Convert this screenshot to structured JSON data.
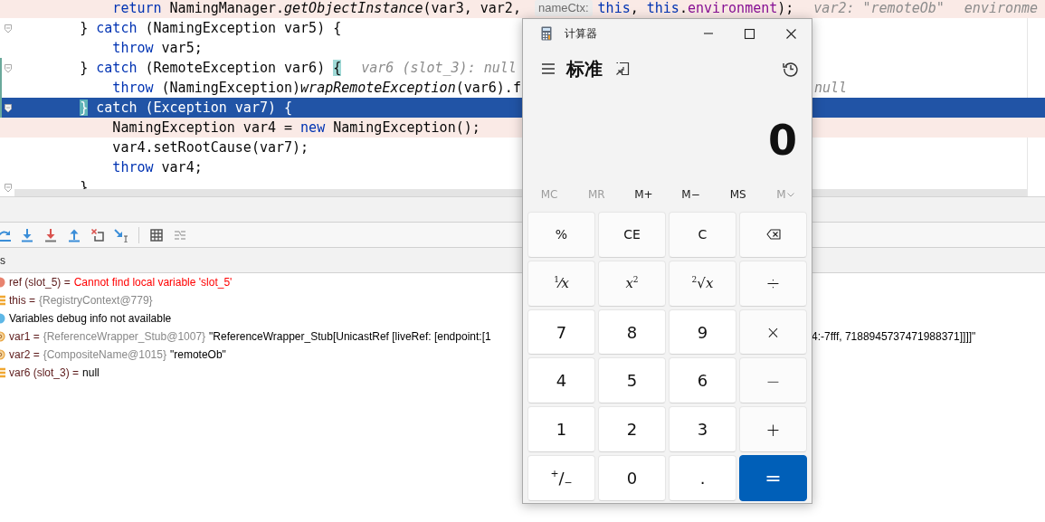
{
  "editor": {
    "lines": [
      {
        "breakpoint": true,
        "current": false,
        "foldable": false,
        "changed": false,
        "tokens": [
          {
            "text": "            return",
            "kind": "keyword"
          },
          {
            "text": " NamingManager.",
            "kind": "plain"
          },
          {
            "text": "getObjectInstance",
            "kind": "static"
          },
          {
            "text": "(var3, var2, ",
            "kind": "plain"
          },
          {
            "text": "nameCtx:",
            "kind": "inlay"
          },
          {
            "text": "this",
            "kind": "keyword"
          },
          {
            "text": ", ",
            "kind": "plain"
          },
          {
            "text": "this",
            "kind": "keyword"
          },
          {
            "text": ".",
            "kind": "plain"
          },
          {
            "text": "environment",
            "kind": "field"
          },
          {
            "text": ");",
            "kind": "plain"
          },
          {
            "text": "var2: \"remoteOb\"",
            "kind": "hint"
          },
          {
            "text": "environme",
            "kind": "hint"
          }
        ]
      },
      {
        "breakpoint": false,
        "current": false,
        "foldable": true,
        "changed": false,
        "tokens": [
          {
            "text": "        } ",
            "kind": "plain"
          },
          {
            "text": "catch",
            "kind": "keyword"
          },
          {
            "text": " (NamingException var5) {",
            "kind": "plain"
          }
        ]
      },
      {
        "breakpoint": false,
        "current": false,
        "foldable": false,
        "changed": false,
        "tokens": [
          {
            "text": "            throw",
            "kind": "keyword"
          },
          {
            "text": " var5;",
            "kind": "plain"
          }
        ]
      },
      {
        "breakpoint": false,
        "current": false,
        "foldable": true,
        "changed": true,
        "tokens": [
          {
            "text": "        } ",
            "kind": "plain"
          },
          {
            "text": "catch",
            "kind": "keyword"
          },
          {
            "text": " (RemoteException var6) ",
            "kind": "plain"
          },
          {
            "text": "{",
            "kind": "brace"
          },
          {
            "text": "var6 (slot_3): null",
            "kind": "hint"
          }
        ]
      },
      {
        "breakpoint": false,
        "current": false,
        "foldable": false,
        "changed": true,
        "tokens": [
          {
            "text": "            throw",
            "kind": "keyword"
          },
          {
            "text": " (NamingException)",
            "kind": "plain"
          },
          {
            "text": "wrapRemoteException",
            "kind": "static"
          },
          {
            "text": "(var6).f",
            "kind": "plain"
          }
        ],
        "tail": [
          {
            "text": "null",
            "kind": "hint"
          }
        ]
      },
      {
        "breakpoint": false,
        "current": true,
        "foldable": true,
        "changed": true,
        "tokens": [
          {
            "text": "        }",
            "kind": "brace"
          },
          {
            "text": " catch",
            "kind": "keyword"
          },
          {
            "text": " (Exception var7) {",
            "kind": "plain"
          }
        ]
      },
      {
        "breakpoint": true,
        "current": false,
        "foldable": false,
        "changed": false,
        "tokens": [
          {
            "text": "            NamingException var4 = ",
            "kind": "plain"
          },
          {
            "text": "new",
            "kind": "keyword"
          },
          {
            "text": " NamingException();",
            "kind": "plain"
          }
        ]
      },
      {
        "breakpoint": false,
        "current": false,
        "foldable": false,
        "changed": false,
        "tokens": [
          {
            "text": "            var4.setRootCause(var7);",
            "kind": "plain"
          }
        ]
      },
      {
        "breakpoint": false,
        "current": false,
        "foldable": false,
        "changed": false,
        "tokens": [
          {
            "text": "            throw",
            "kind": "keyword"
          },
          {
            "text": " var4;",
            "kind": "plain"
          }
        ]
      },
      {
        "breakpoint": false,
        "current": false,
        "foldable": true,
        "changed": false,
        "tokens": [
          {
            "text": "        }",
            "kind": "plain"
          }
        ]
      }
    ]
  },
  "debugger": {
    "toolbar": [
      {
        "kind": "step-over"
      },
      {
        "kind": "step-into"
      },
      {
        "kind": "force-step-into"
      },
      {
        "kind": "step-out"
      },
      {
        "kind": "drop-frame"
      },
      {
        "kind": "run-to-cursor"
      },
      {
        "kind": "separator"
      },
      {
        "kind": "evaluate"
      },
      {
        "kind": "trace"
      }
    ],
    "panel_title": "s",
    "variables": [
      {
        "kind": "error",
        "name": "ref (slot_5) =",
        "value": "Cannot find local variable 'slot_5'"
      },
      {
        "kind": "field",
        "name": "this =",
        "type": "{RegistryContext@779}"
      },
      {
        "kind": "info",
        "message": "Variables debug info not available"
      },
      {
        "kind": "param",
        "name": "var1 =",
        "type": "{ReferenceWrapper_Stub@1007}",
        "value": "\"ReferenceWrapper_Stub[UnicastRef [liveRef: [endpoint:[1",
        "tail": "4:-7fff, 7188945737471988371]]]]\""
      },
      {
        "kind": "param",
        "name": "var2 =",
        "type": "{CompositeName@1015}",
        "value": "\"remoteOb\""
      },
      {
        "kind": "field",
        "name": "var6 (slot_3) =",
        "value": "null"
      }
    ]
  },
  "calculator": {
    "title": "计算器",
    "mode": "标准",
    "display": "0",
    "memory": [
      {
        "label": "MC",
        "disabled": true,
        "kind": "button"
      },
      {
        "label": "MR",
        "disabled": true,
        "kind": "button"
      },
      {
        "label": "M+",
        "disabled": false,
        "kind": "button"
      },
      {
        "label": "M−",
        "disabled": false,
        "kind": "button"
      },
      {
        "label": "MS",
        "disabled": false,
        "kind": "button"
      },
      {
        "label": "M",
        "disabled": true,
        "kind": "dropdown"
      }
    ],
    "keys": [
      {
        "label": "%",
        "kind": "function"
      },
      {
        "label": "CE",
        "kind": "function"
      },
      {
        "label": "C",
        "kind": "function"
      },
      {
        "kind": "backspace"
      },
      {
        "label": "$^{1}$⁄*x*",
        "kind": "formula"
      },
      {
        "label": "*x*$^{2}$",
        "kind": "formula"
      },
      {
        "label": "$^{2}$√*x*",
        "kind": "formula"
      },
      {
        "label": "÷",
        "kind": "operator"
      },
      {
        "label": "7",
        "kind": "digit"
      },
      {
        "label": "8",
        "kind": "digit"
      },
      {
        "label": "9",
        "kind": "digit"
      },
      {
        "label": "×",
        "kind": "operator"
      },
      {
        "label": "4",
        "kind": "digit"
      },
      {
        "label": "5",
        "kind": "digit"
      },
      {
        "label": "6",
        "kind": "digit"
      },
      {
        "label": "−",
        "kind": "operator"
      },
      {
        "label": "1",
        "kind": "digit"
      },
      {
        "label": "2",
        "kind": "digit"
      },
      {
        "label": "3",
        "kind": "digit"
      },
      {
        "label": "+",
        "kind": "operator"
      },
      {
        "label": "$^{+}$/$_{−}$",
        "kind": "digit"
      },
      {
        "label": "0",
        "kind": "digit"
      },
      {
        "label": ".",
        "kind": "digit"
      },
      {
        "label": "=",
        "kind": "equals"
      }
    ]
  }
}
